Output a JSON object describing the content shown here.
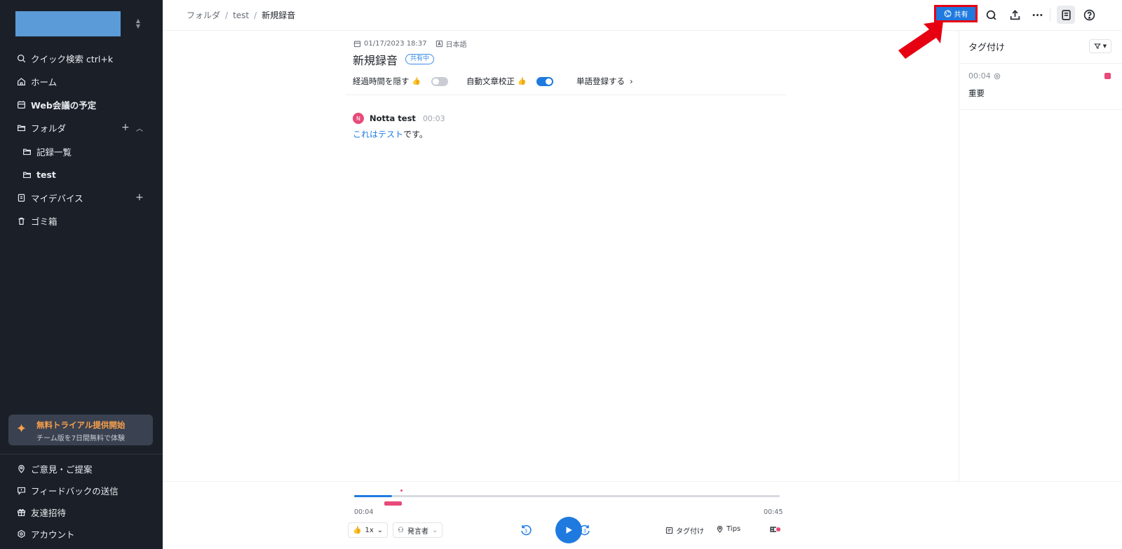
{
  "sidebar": {
    "quick_search": "クイック検索 ctrl+k",
    "home": "ホーム",
    "meetings": "Web会議の予定",
    "folders": "フォルダ",
    "folder_list": "記録一覧",
    "folder_test": "test",
    "my_devices": "マイデバイス",
    "trash": "ゴミ箱",
    "trial_title": "無料トライアル提供開始",
    "trial_sub": "チーム版を7日間無料で体験",
    "feedback_idea": "ご意見・ご提案",
    "feedback_send": "フィードバックの送信",
    "invite": "友達招待",
    "account": "アカウント"
  },
  "topbar": {
    "breadcrumb": [
      "フォルダ",
      "test",
      "新規録音"
    ],
    "share_label": "共有"
  },
  "doc": {
    "date": "01/17/2023 18:37",
    "language": "日本語",
    "title": "新規録音",
    "status_badge": "共有中",
    "hide_elapsed": "経過時間を隠す",
    "auto_proofread": "自動文章校正",
    "word_register": "単語登録する",
    "hide_elapsed_on": false,
    "auto_proofread_on": true
  },
  "transcript": [
    {
      "avatar": "N",
      "speaker": "Notta test",
      "time": "00:03",
      "text_highlight": "これはテスト",
      "text_rest": "です。"
    }
  ],
  "tags_panel": {
    "title": "タグ付け",
    "items": [
      {
        "time": "00:04",
        "label": "重要",
        "color": "#e84a7a"
      }
    ]
  },
  "player": {
    "current_time": "00:04",
    "total_time": "00:45",
    "progress": 0.089,
    "speed": "1x",
    "speaker_filter": "発言者",
    "skip_back": "3",
    "skip_forward": "3",
    "tag_action": "タグ付け",
    "tips_action": "Tips"
  },
  "colors": {
    "accent": "#1f7ae0",
    "sidebar_bg": "#1b2028",
    "tag_pink": "#e84a7a",
    "annotation_red": "#e60012"
  }
}
